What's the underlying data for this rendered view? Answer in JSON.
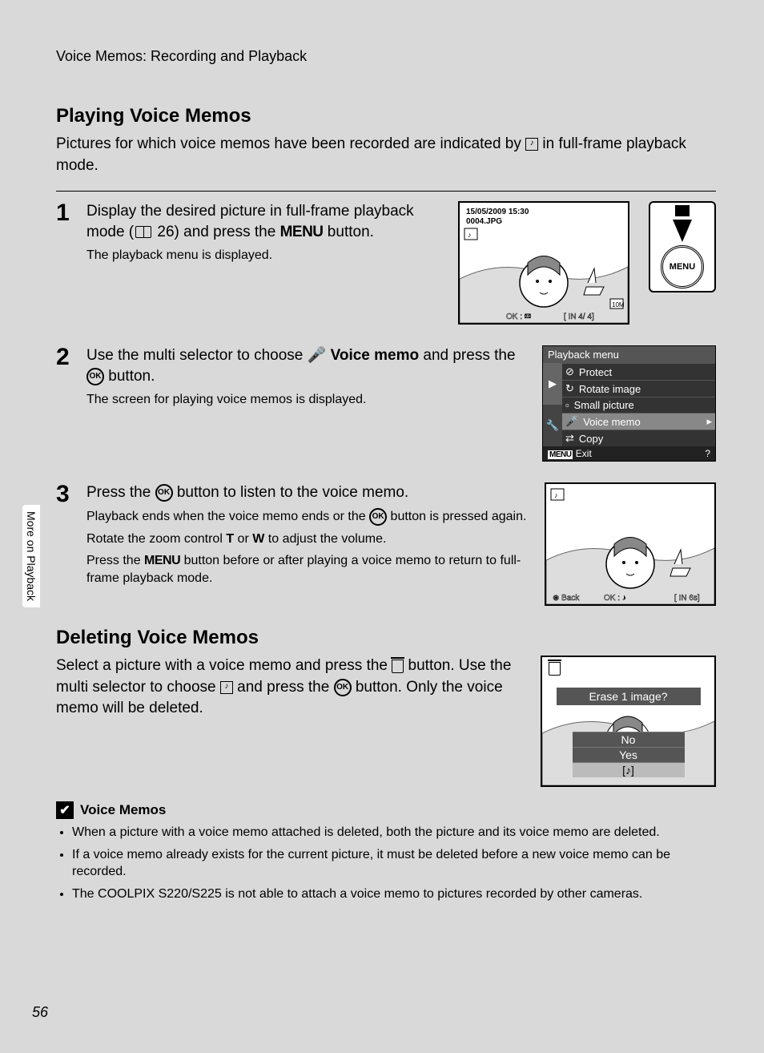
{
  "header": "Voice Memos: Recording and Playback",
  "h_play": "Playing Voice Memos",
  "intro_play_a": "Pictures for which voice memos have been recorded are indicated by ",
  "intro_play_b": " in full-frame playback mode.",
  "step1_a": "Display the desired picture in full-frame playback mode (",
  "step1_ref": " 26) and press the ",
  "step1_b": " button.",
  "step1_sub": "The playback menu is displayed.",
  "step2_a": "Use the multi selector to choose ",
  "step2_bold": "Voice memo",
  "step2_b": " and press the ",
  "step2_c": " button.",
  "step2_sub": "The screen for playing voice memos is displayed.",
  "step3_a": "Press the ",
  "step3_b": " button to listen to the voice memo.",
  "step3_sub1_a": "Playback ends when the voice memo ends or the ",
  "step3_sub1_b": " button is pressed again.",
  "step3_sub2_a": "Rotate the zoom control ",
  "step3_sub2_t": "T",
  "step3_sub2_or": " or ",
  "step3_sub2_w": "W",
  "step3_sub2_b": " to adjust the volume.",
  "step3_sub3_a": "Press the ",
  "step3_sub3_b": " button before or after playing a voice memo to return to full-frame playback mode.",
  "h_delete": "Deleting Voice Memos",
  "delete_a": "Select a picture with a voice memo and press the ",
  "delete_b": " button. Use the multi selector to choose ",
  "delete_c": " and press the ",
  "delete_d": " button. Only the voice memo will be deleted.",
  "note_title": "Voice Memos",
  "note1": "When a picture with a voice memo attached is deleted, both the picture and its voice memo are deleted.",
  "note2": "If a voice memo already exists for the current picture, it must be deleted before a new voice memo can be recorded.",
  "note3": "The COOLPIX S220/S225 is not able to attach a voice memo to pictures recorded by other cameras.",
  "side_tab": "More on Playback",
  "page_num": "56",
  "lcd1": {
    "date": "15/05/2009 15:30",
    "file": "0004.JPG",
    "counter": "4/   4]",
    "ok": "OK :"
  },
  "menu_btn": "MENU",
  "pbmenu": {
    "title": "Playback menu",
    "items": [
      "Protect",
      "Rotate image",
      "Small picture",
      "Voice memo",
      "Copy"
    ],
    "exit": "Exit"
  },
  "lcd3": {
    "back": "Back",
    "ok": "OK :",
    "time": "6s]"
  },
  "erase": {
    "q": "Erase 1 image?",
    "no": "No",
    "yes": "Yes"
  }
}
